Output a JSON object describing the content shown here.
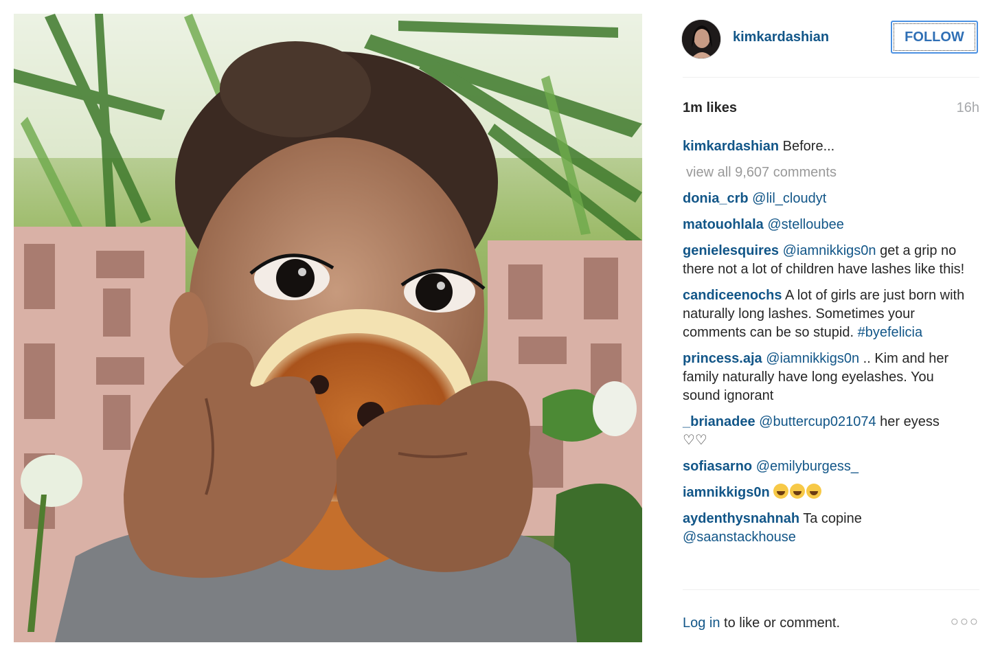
{
  "post": {
    "username": "kimkardashian",
    "follow_label": "FOLLOW",
    "likes": "1m likes",
    "time": "16h",
    "caption_user": "kimkardashian",
    "caption_text": "Before...",
    "view_all": "view all 9,607 comments",
    "comments": [
      {
        "user": "donia_crb",
        "mention": "@lil_cloudyt",
        "text": ""
      },
      {
        "user": "matouohlala",
        "mention": "@stelloubee",
        "text": ""
      },
      {
        "user": "genielesquires",
        "mention": "@iamnikkigs0n",
        "text": "get a grip no there not a lot of children have lashes like this!"
      },
      {
        "user": "candiceenochs",
        "mention": "",
        "text": "A lot of girls are just born with naturally long lashes. Sometimes your comments can be so stupid.",
        "tag": "#byefelicia"
      },
      {
        "user": "princess.aja",
        "mention": "@iamnikkigs0n",
        "text": ".. Kim and her family naturally have long eyelashes. You sound ignorant"
      },
      {
        "user": "_brianadee",
        "mention": "@buttercup021074",
        "text": "her eyess",
        "extra": "♡♡"
      },
      {
        "user": "sofiasarno",
        "mention": "@emilyburgess_",
        "text": ""
      },
      {
        "user": "iamnikkigs0n",
        "mention": "",
        "text": "",
        "emoji": "joy-emoji x3"
      },
      {
        "user": "aydenthysnahnah",
        "mention": "",
        "text": "Ta copine",
        "mention2": "@saanstackhouse"
      }
    ],
    "footer_login": "Log in",
    "footer_rest": " to like or comment.",
    "more": "○○○"
  },
  "colors": {
    "link": "#125688",
    "follow_border": "#4a90e2",
    "muted": "#999999"
  },
  "icons": [
    "avatar",
    "joy-emoji",
    "more-options-icon"
  ]
}
